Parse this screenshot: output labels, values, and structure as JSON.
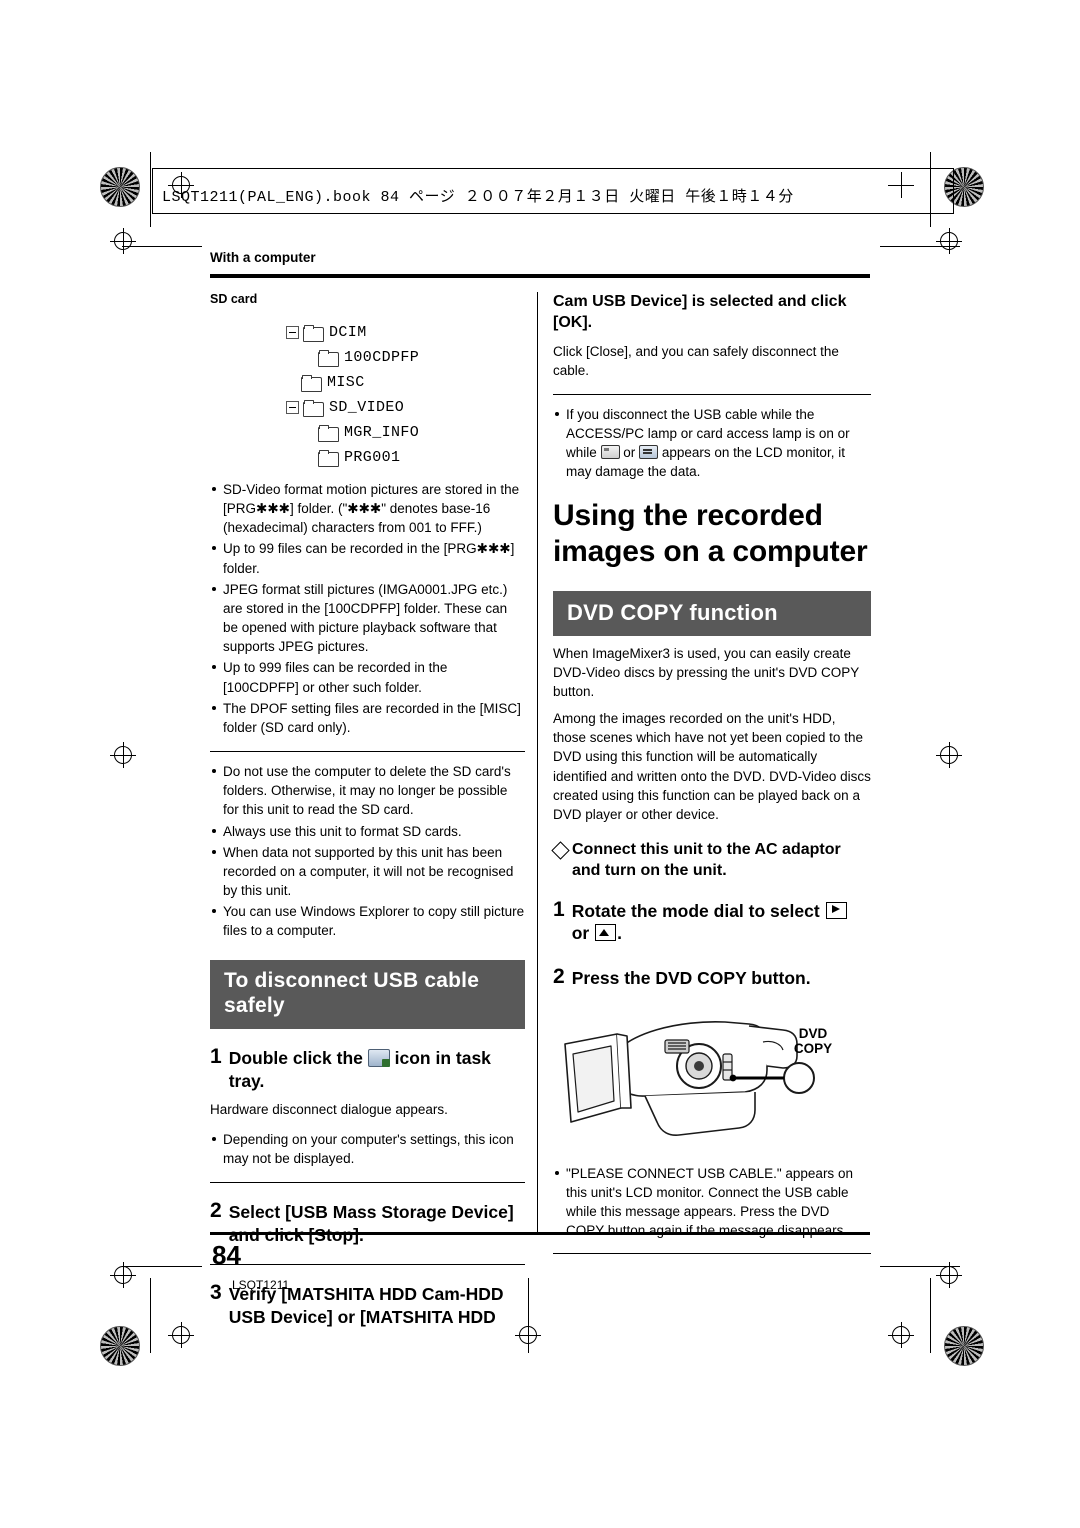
{
  "print_marks": {
    "book_line": "LSQT1211(PAL_ENG).book  84 ページ  ２００７年２月１３日  火曜日  午後１時１４分"
  },
  "header": {
    "running_head": "With a computer"
  },
  "left_column": {
    "sd_card_label": "SD card",
    "tree": [
      {
        "level": 0,
        "expander": true,
        "label": "DCIM"
      },
      {
        "level": 1,
        "expander": false,
        "label": "100CDPFP"
      },
      {
        "level": 0,
        "expander": false,
        "label": "MISC"
      },
      {
        "level": 0,
        "expander": true,
        "label": "SD_VIDEO"
      },
      {
        "level": 1,
        "expander": false,
        "label": "MGR_INFO"
      },
      {
        "level": 1,
        "expander": false,
        "label": "PRG001"
      }
    ],
    "bullets_group_1": [
      "SD-Video format motion pictures are stored in the [PRG✱✱✱] folder. (\"✱✱✱\" denotes base-16 (hexadecimal) characters from 001 to FFF.)",
      "Up to 99 files can be recorded in the [PRG✱✱✱] folder.",
      "JPEG format still pictures (IMGA0001.JPG etc.) are stored in the [100CDPFP] folder. These can be opened with picture playback software that supports JPEG pictures.",
      "Up to 999 files can be recorded in the [100CDPFP] or other such folder.",
      "The DPOF setting files are recorded in the [MISC] folder (SD card only)."
    ],
    "bullets_group_2": [
      "Do not use the computer to delete the SD card's folders. Otherwise, it may no longer be possible for this unit to read the SD card.",
      "Always use this unit to format SD cards.",
      "When data not supported by this unit has been recorded on a computer, it will not be recognised by this unit.",
      "You can use Windows Explorer to copy still picture files to a computer."
    ],
    "heading_disconnect": "To disconnect USB cable safely",
    "step1_num": "1",
    "step1_text_before": "Double click the",
    "step1_icon": "usb-safely-remove-icon",
    "step1_text_after": "icon in task tray.",
    "step1_para": "Hardware disconnect dialogue appears.",
    "step1_bullet": "Depending on your computer's settings, this icon may not be displayed.",
    "step2_num": "2",
    "step2_text": "Select [USB Mass Storage Device] and click [Stop].",
    "step3_num": "3",
    "step3_text": "Verify [MATSHITA HDD Cam-HDD USB Device] or [MATSHITA HDD"
  },
  "right_column": {
    "continued_heading": "Cam USB Device] is selected and click [OK].",
    "continued_para": "Click [Close], and you can safely disconnect the cable.",
    "warning_bullet_part1": "If you disconnect the USB cable while the ACCESS/PC lamp or card access lamp is on or while",
    "warning_icon_1": "sd-card-icon",
    "warning_mid": "or",
    "warning_icon_2": "usb-plug-icon",
    "warning_bullet_part2": "appears on the LCD monitor, it may damage the data.",
    "big_title": "Using the recorded images on a computer",
    "dvd_copy_heading": "DVD COPY function",
    "body_paragraphs": [
      "When ImageMixer3 is used, you can easily create DVD-Video discs by pressing the unit's DVD COPY button.",
      "Among the images recorded on the unit's HDD, those scenes which have not yet been copied to the DVD using this function will be automatically identified and written onto the DVD. DVD-Video discs created using this function can be played back on a DVD player or other device."
    ],
    "diamond_heading": "Connect this unit to the AC adaptor and turn on the unit.",
    "step1_num": "1",
    "step1_text_before": "Rotate the mode dial to select",
    "step1_icon_1": "playback-mode-icon",
    "step1_text_mid": "or",
    "step1_icon_2": "photo-mode-icon",
    "step1_text_after": ".",
    "step2_num": "2",
    "step2_text": "Press the DVD COPY button.",
    "illustration": {
      "name": "camcorder-illustration",
      "callout_line1": "DVD",
      "callout_line2": "COPY"
    },
    "closing_bullet": "\"PLEASE CONNECT USB CABLE.\" appears on this unit's LCD monitor. Connect the USB cable while this message appears. Press the DVD COPY button again if the message disappears."
  },
  "footer": {
    "page_number": "84",
    "doc_code": "LSQT1211"
  },
  "colors": {
    "heading_bar": "#595959",
    "text": "#000000",
    "background": "#ffffff"
  }
}
